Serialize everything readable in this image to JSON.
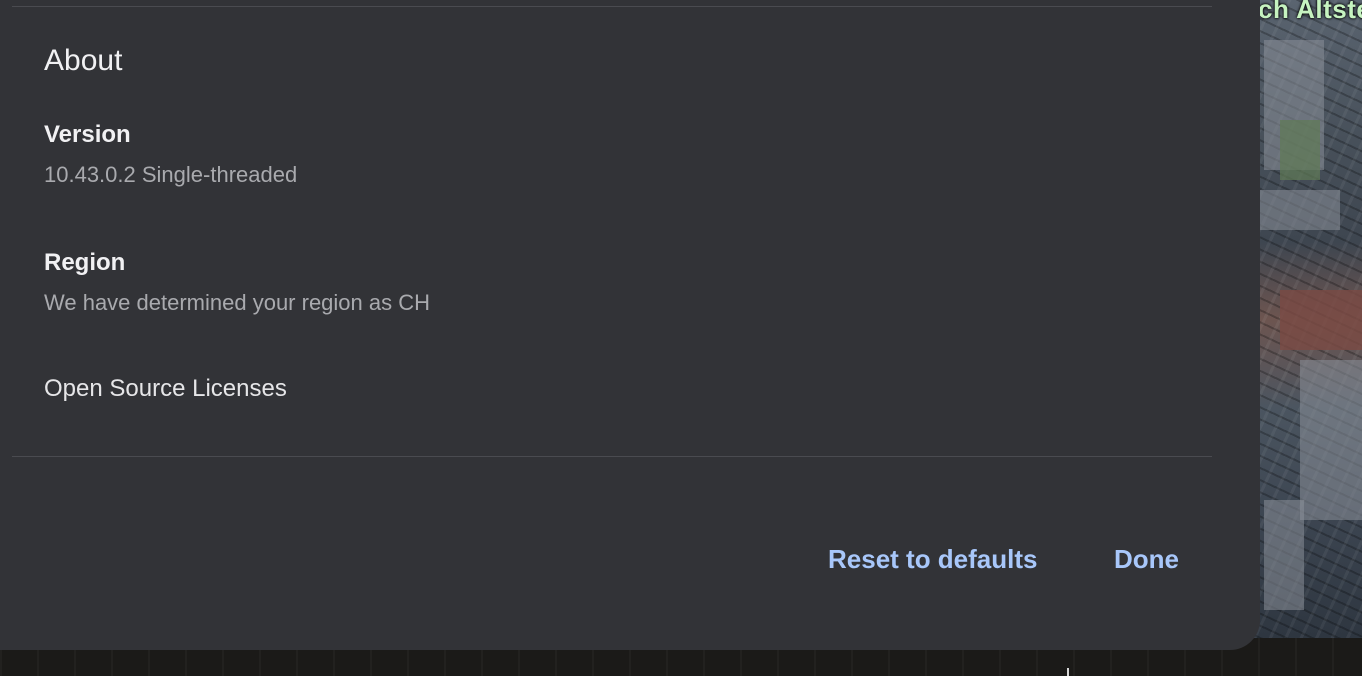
{
  "map": {
    "label": "ch Altste"
  },
  "about": {
    "title": "About",
    "version": {
      "label": "Version",
      "value": "10.43.0.2 Single-threaded"
    },
    "region": {
      "label": "Region",
      "value": "We have determined your region as CH"
    },
    "licenses_label": "Open Source Licenses"
  },
  "footer": {
    "reset_label": "Reset to defaults",
    "done_label": "Done"
  },
  "colors": {
    "panel": "#323337",
    "accent": "#a8c7fa",
    "text_primary": "#f1f1f3",
    "text_secondary": "#a9aaae"
  }
}
